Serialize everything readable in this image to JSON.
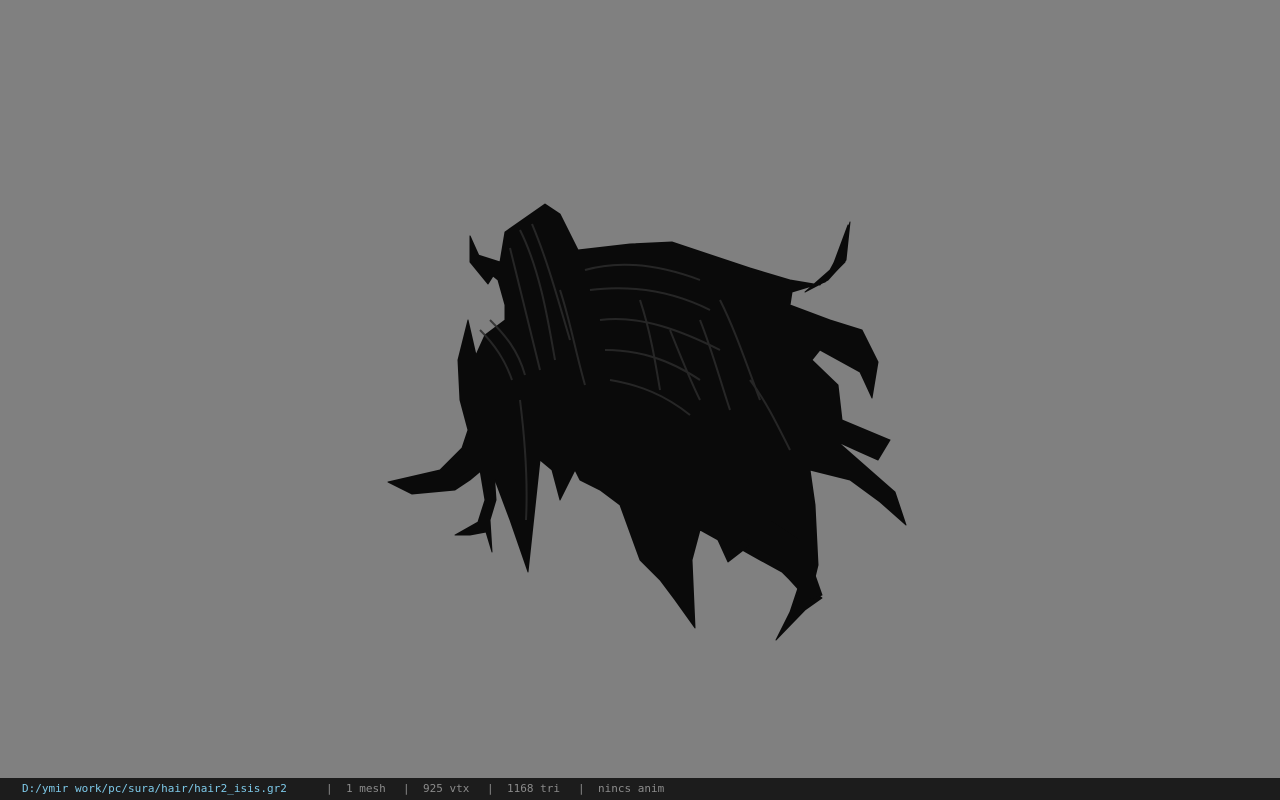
{
  "viewport": {
    "background_color": "#808080",
    "model_color": "#0a0a0a",
    "model_highlight_color": "#2c2c2c",
    "model_icon": "hair-mesh-model"
  },
  "statusbar": {
    "background_color": "#1c1c1c",
    "path_color": "#7cc7e6",
    "text_color": "#8a8a8a",
    "file_path": "D:/ymir work/pc/sura/hair/hair2_isis.gr2",
    "separator": "|",
    "mesh_count": "1 mesh",
    "vertex_count": "925 vtx",
    "triangle_count": "1168 tri",
    "anim_status": "nincs anim"
  }
}
